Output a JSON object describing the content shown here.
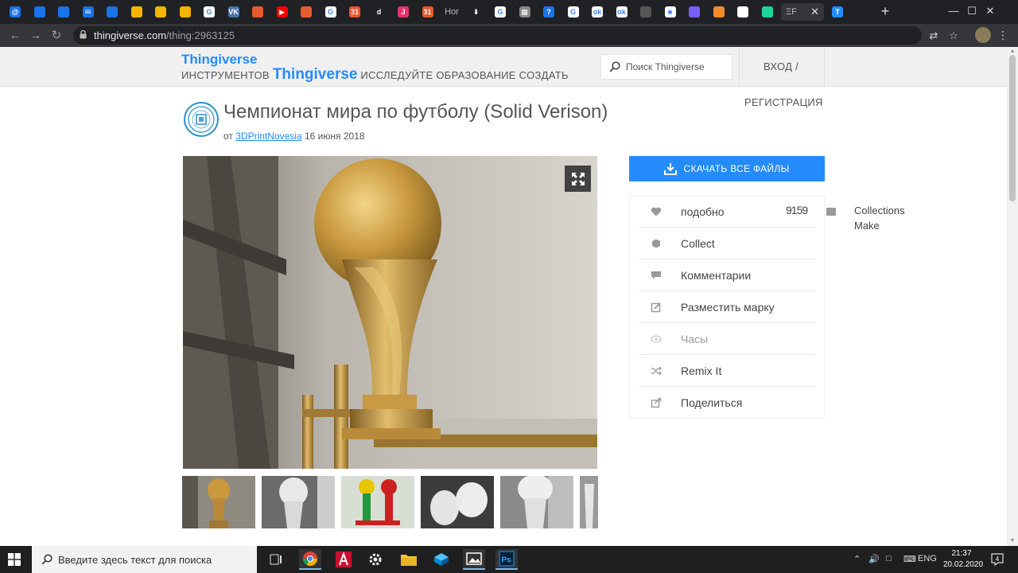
{
  "browser": {
    "tabs": [
      {
        "icon": "mail-icon",
        "color": "#1a73e8",
        "glyph": "@"
      },
      {
        "icon": "window-icon",
        "color": "#1a73e8",
        "glyph": ""
      },
      {
        "icon": "window-icon",
        "color": "#1a73e8",
        "glyph": ""
      },
      {
        "icon": "mail-icon",
        "color": "#1a73e8",
        "glyph": "✉"
      },
      {
        "icon": "weather-icon",
        "color": "#1a73e8",
        "glyph": ""
      },
      {
        "icon": "yellow-circle-icon",
        "color": "#f4b400",
        "glyph": ""
      },
      {
        "icon": "yellow-circle-icon",
        "color": "#f4b400",
        "glyph": ""
      },
      {
        "icon": "yellow-circle-icon",
        "color": "#f4b400",
        "glyph": ""
      },
      {
        "icon": "google-icon",
        "color": "#ffffff",
        "glyph": "G"
      },
      {
        "icon": "vk-icon",
        "color": "#4a76a8",
        "glyph": "VK"
      },
      {
        "icon": "orange-circle-icon",
        "color": "#e65c2c",
        "glyph": ""
      },
      {
        "icon": "youtube-icon",
        "color": "#ff0000",
        "glyph": "▶"
      },
      {
        "icon": "orange-circle-icon",
        "color": "#e65c2c",
        "glyph": ""
      },
      {
        "icon": "google-icon",
        "color": "#ffffff",
        "glyph": "G"
      },
      {
        "icon": "calendar-icon",
        "color": "#e8572c",
        "glyph": "31"
      },
      {
        "icon": "tiktok-icon",
        "color": "#202124",
        "glyph": "d"
      },
      {
        "icon": "j-icon",
        "color": "#e8326b",
        "glyph": "J"
      },
      {
        "icon": "calendar-icon",
        "color": "#e8572c",
        "glyph": "31"
      },
      {
        "icon": "text-tab",
        "color": "#202124",
        "glyph": "Hor"
      },
      {
        "icon": "download-icon",
        "color": "#202124",
        "glyph": "⬇"
      },
      {
        "icon": "google-icon",
        "color": "#ffffff",
        "glyph": "G"
      },
      {
        "icon": "grid-icon",
        "color": "#888888",
        "glyph": "▦"
      },
      {
        "icon": "question-icon",
        "color": "#1a73e8",
        "glyph": "?"
      },
      {
        "icon": "google-icon",
        "color": "#ffffff",
        "glyph": "G"
      },
      {
        "icon": "ok-icon",
        "color": "#ffffff",
        "glyph": "ok"
      },
      {
        "icon": "ok-icon",
        "color": "#ffffff",
        "glyph": "ok"
      },
      {
        "icon": "globe-icon",
        "color": "#555555",
        "glyph": ""
      },
      {
        "icon": "square-icon",
        "color": "#ffffff",
        "glyph": "■"
      },
      {
        "icon": "purple-blob-icon",
        "color": "#7b5cff",
        "glyph": ""
      },
      {
        "icon": "fruit-icon",
        "color": "#f28c28",
        "glyph": ""
      },
      {
        "icon": "game-icon",
        "color": "#ffffff",
        "glyph": ""
      },
      {
        "icon": "cube-icon",
        "color": "#1ed49b",
        "glyph": ""
      },
      {
        "icon": "text-tab",
        "color": "#202124",
        "glyph": "ΞF"
      },
      {
        "icon": "thingiverse-icon",
        "color": "#248bfb",
        "glyph": "T"
      }
    ],
    "active_tab_icon": "thingiverse-icon",
    "url_host": "thingiverse.com",
    "url_path": "/thing:2963125"
  },
  "header": {
    "logo_small": "Thingiverse",
    "nav_left": "ИНСТРУМЕНТОВ",
    "logo_big": "Thingiverse",
    "nav_right": "ИССЛЕДУЙТЕ ОБРАЗОВАНИЕ СОЗДАТЬ",
    "search_placeholder": "Поиск Thingiverse",
    "login": "ВХОД /",
    "register": "РЕГИСТРАЦИЯ"
  },
  "thing": {
    "title": "Чемпионат мира по футболу (Solid Verison)",
    "by": "от",
    "author": "3DPrintNovesia",
    "date": "16 июня 2018"
  },
  "download_label": "СКАЧАТЬ ВСЕ ФАЙЛЫ",
  "actions": [
    {
      "label": "подобно",
      "icon": "heart-icon"
    },
    {
      "label": "Collect",
      "icon": "collect-icon"
    },
    {
      "label": "Комментарии",
      "icon": "comment-icon"
    },
    {
      "label": "Разместить марку",
      "icon": "post-make-icon"
    },
    {
      "label": "Часы",
      "icon": "watch-icon"
    },
    {
      "label": "Remix It",
      "icon": "remix-icon"
    },
    {
      "label": "Поделиться",
      "icon": "share-icon"
    }
  ],
  "overlap": {
    "counter": "9159",
    "side_text_1": "Collections",
    "side_text_2": "Make"
  },
  "taskbar": {
    "search_placeholder": "Введите здесь текст для поиска",
    "lang": "ENG",
    "time": "21:37",
    "date": "20.02.2020",
    "notifications": "4"
  }
}
